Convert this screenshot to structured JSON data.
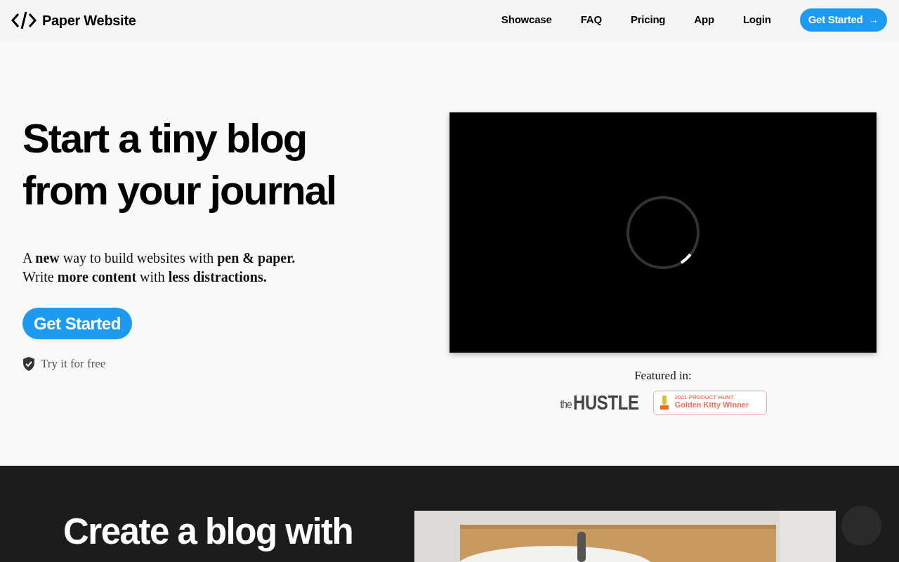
{
  "navbar": {
    "brand": "Paper Website",
    "links": [
      {
        "label": "Showcase"
      },
      {
        "label": "FAQ"
      },
      {
        "label": "Pricing"
      },
      {
        "label": "App"
      },
      {
        "label": "Login"
      }
    ],
    "cta": {
      "label": "Get Started",
      "arrow": "→"
    }
  },
  "hero": {
    "headline_lines": [
      "Start a tiny blog",
      "from your journal"
    ],
    "tagline_lines": [
      "A **new** way to build websites with **pen & paper.**",
      "Write **more content** with **less distractions.**"
    ],
    "button": "Get Started",
    "note": "Try it for free",
    "video": {
      "loading": true
    },
    "featured": {
      "label": "Featured in:",
      "hustle": {
        "small": "the",
        "big": "HUSTLE"
      },
      "badge": {
        "overline": "2021 PRODUCT HUNT",
        "title": "Golden Kitty Winner"
      }
    }
  },
  "section": {
    "heading": "Create a blog with"
  }
}
